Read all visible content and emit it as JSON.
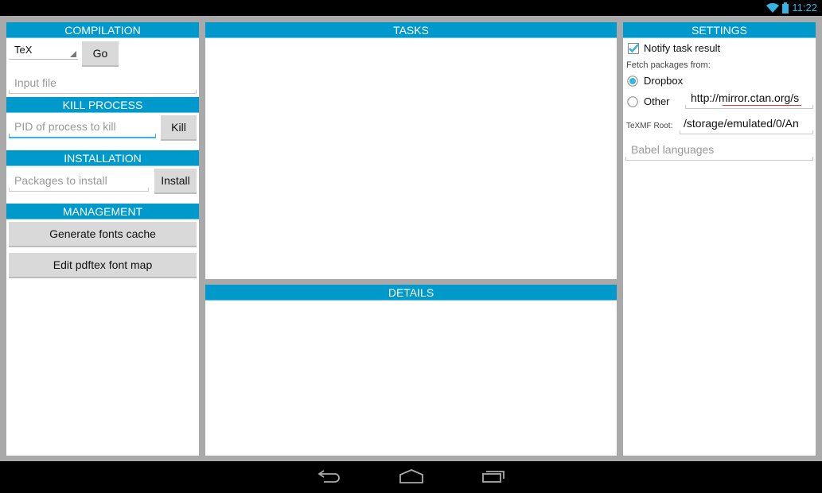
{
  "status_bar": {
    "time": "11:22",
    "icons": [
      "wifi-icon",
      "battery-icon"
    ],
    "accent": "#33b5e5"
  },
  "compilation": {
    "title": "COMPILATION",
    "engine_selected": "TeX",
    "go_label": "Go",
    "input_placeholder": "Input file"
  },
  "kill_process": {
    "title": "KILL PROCESS",
    "pid_placeholder": "PID of process to kill",
    "kill_label": "Kill"
  },
  "installation": {
    "title": "INSTALLATION",
    "packages_placeholder": "Packages to install",
    "install_label": "Install"
  },
  "management": {
    "title": "MANAGEMENT",
    "buttons": [
      "Generate fonts cache",
      "Edit pdftex font map"
    ]
  },
  "tasks": {
    "title": "TASKS"
  },
  "details": {
    "title": "DETAILS"
  },
  "settings": {
    "title": "SETTINGS",
    "notify_label": "Notify task result",
    "notify_checked": true,
    "fetch_label": "Fetch packages from:",
    "source_options": [
      "Dropbox",
      "Other"
    ],
    "source_selected": "Dropbox",
    "other_url": "http://mirror.ctan.org/s",
    "texmf_label": "TeXMF Root:",
    "texmf_value": "/storage/emulated/0/An",
    "babel_placeholder": "Babel languages"
  },
  "colors": {
    "header": "#0099cc",
    "background": "#a9a9a9"
  },
  "navbar": {
    "buttons": [
      "back-icon",
      "home-icon",
      "recents-icon"
    ]
  }
}
